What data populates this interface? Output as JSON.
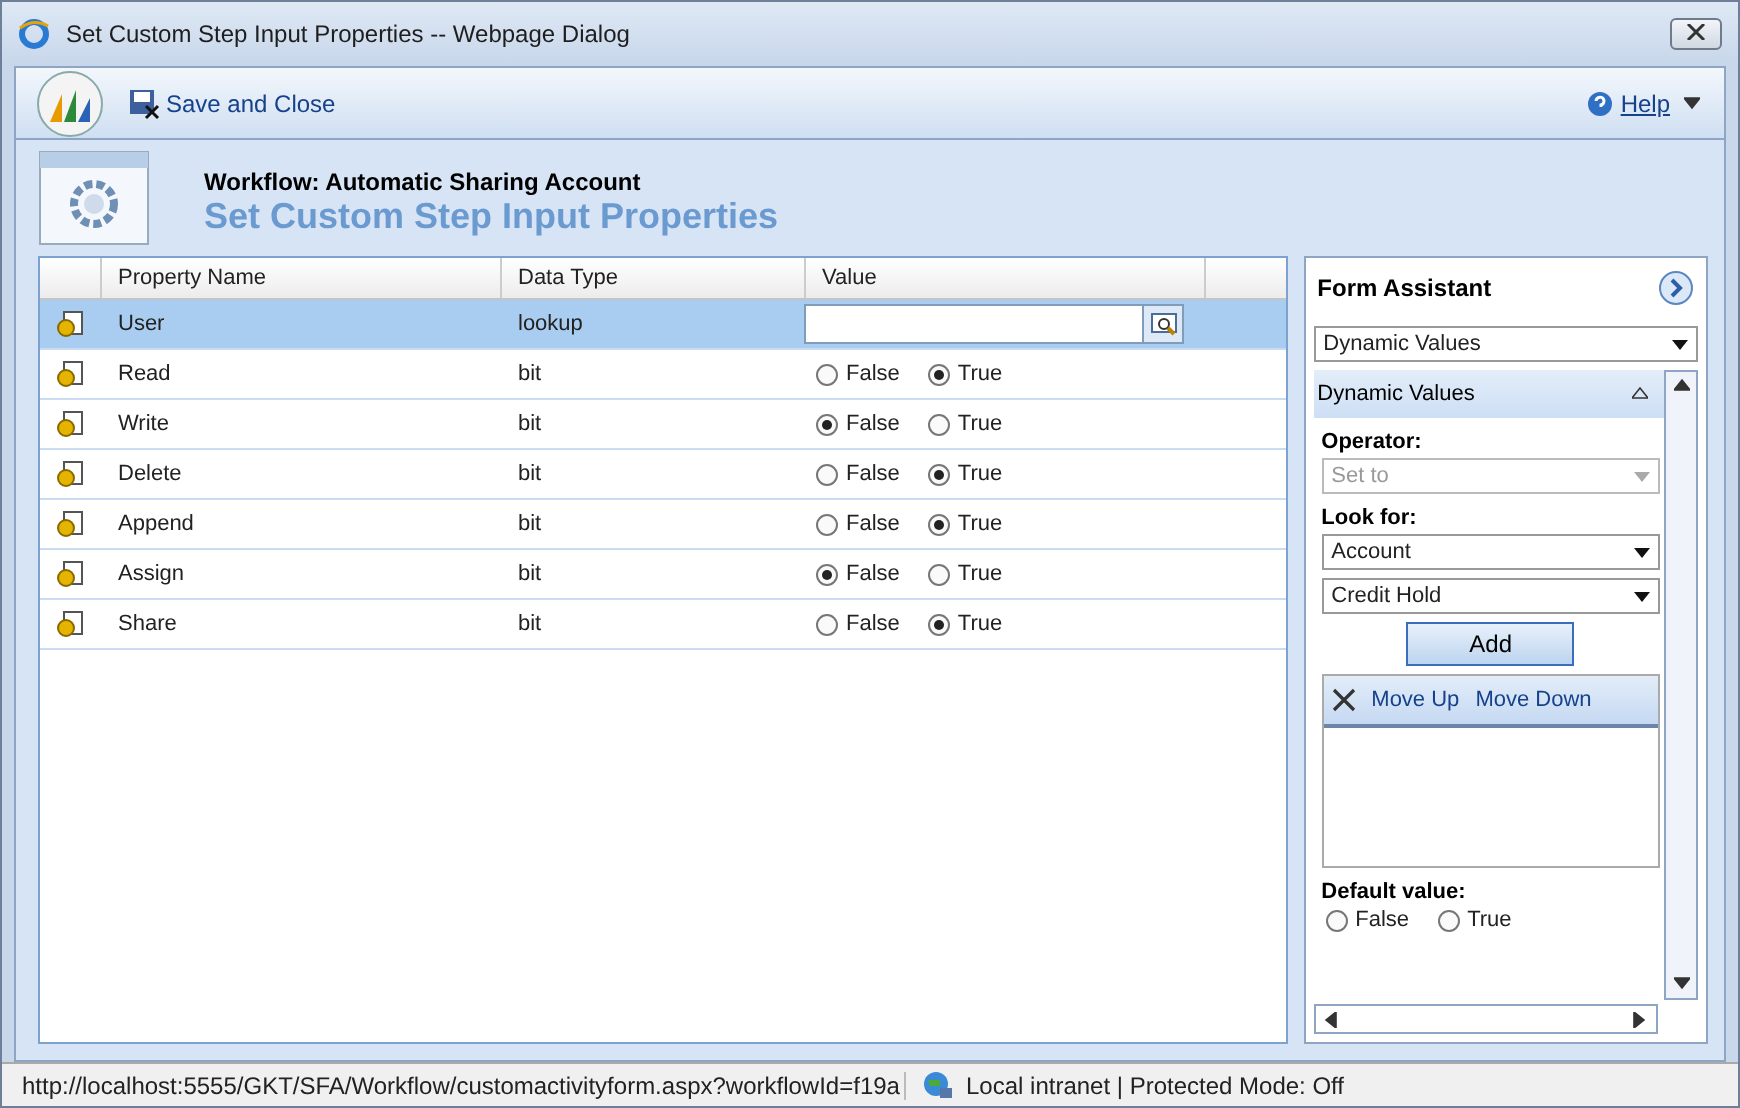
{
  "window": {
    "title": "Set Custom Step Input Properties -- Webpage Dialog"
  },
  "toolbar": {
    "save_label": "Save and Close",
    "help_label": "Help"
  },
  "header": {
    "subtitle": "Workflow: Automatic Sharing Account",
    "title": "Set Custom Step Input Properties"
  },
  "table": {
    "columns": [
      "Property Name",
      "Data Type",
      "Value"
    ],
    "rows": [
      {
        "name": "User",
        "type": "lookup",
        "kind": "lookup",
        "selected": true
      },
      {
        "name": "Read",
        "type": "bit",
        "kind": "bit",
        "selected": false,
        "options": [
          {
            "label": "False",
            "selected": false
          },
          {
            "label": "True",
            "selected": true
          }
        ]
      },
      {
        "name": "Write",
        "type": "bit",
        "kind": "bit",
        "selected": false,
        "options": [
          {
            "label": "False",
            "selected": true
          },
          {
            "label": "True",
            "selected": false
          }
        ]
      },
      {
        "name": "Delete",
        "type": "bit",
        "kind": "bit",
        "selected": false,
        "options": [
          {
            "label": "False",
            "selected": false
          },
          {
            "label": "True",
            "selected": true
          }
        ]
      },
      {
        "name": "Append",
        "type": "bit",
        "kind": "bit",
        "selected": false,
        "options": [
          {
            "label": "False",
            "selected": false
          },
          {
            "label": "True",
            "selected": true
          }
        ]
      },
      {
        "name": "Assign",
        "type": "bit",
        "kind": "bit",
        "selected": false,
        "options": [
          {
            "label": "False",
            "selected": true
          },
          {
            "label": "True",
            "selected": false
          }
        ]
      },
      {
        "name": "Share",
        "type": "bit",
        "kind": "bit",
        "selected": false,
        "options": [
          {
            "label": "False",
            "selected": false
          },
          {
            "label": "True",
            "selected": true
          }
        ]
      }
    ]
  },
  "assistant": {
    "title": "Form Assistant",
    "dropdown": "Dynamic Values",
    "section": "Dynamic Values",
    "operator_label": "Operator:",
    "operator": "Set to",
    "look_for_label": "Look for:",
    "entity": "Account",
    "attribute": "Credit Hold",
    "add": "Add",
    "move_up": "Move Up",
    "move_down": "Move Down",
    "default_label": "Default value:",
    "default_options": [
      {
        "label": "False",
        "selected": false
      },
      {
        "label": "True",
        "selected": false
      }
    ]
  },
  "status_bar": {
    "url": "http://localhost:5555/GKT/SFA/Workflow/customactivityform.aspx?workflowId=f19a",
    "zone": "Local intranet | Protected Mode: Off"
  }
}
